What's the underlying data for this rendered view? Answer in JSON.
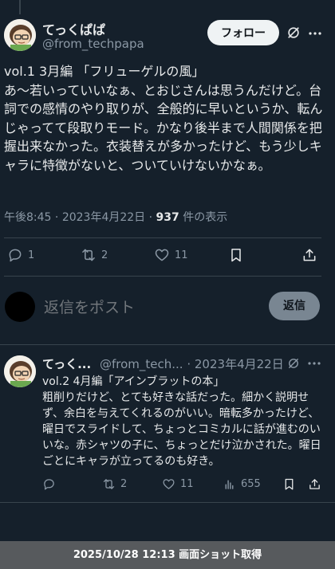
{
  "main_tweet": {
    "author_name": "てっくぱぱ",
    "handle": "@from_techpapa",
    "follow_label": "フォロー",
    "text": "vol.1 3月編 「フリューゲルの風」\nあ〜若いっていいなぁ、とおじさんは思うんだけど。台詞での感情のやり取りが、全般的に早いというか、転んじゃってて段取りモード。かなり後半まで人間関係を把握出来なかった。衣装替えが多かったけど、もう少しキャラに特徴がないと、ついていけないかなぁ。",
    "time": "午後8:45",
    "date": "2023年4月22日",
    "views_count": "937",
    "views_label": "件の表示",
    "replies": "1",
    "reposts": "2",
    "likes": "11"
  },
  "reply_bar": {
    "placeholder": "返信をポスト",
    "button_label": "返信"
  },
  "second_tweet": {
    "author_name": "てっく...",
    "handle": "@from_tech...",
    "date": "2023年4月22日",
    "text": "vol.2 4月編「アインブラットの本」\n粗削りだけど、とても好きな話だった。細かく説明せず、余白を与えてくれるのがいい。暗転多かったけど、曜日でスライドして、ちょっとコミカルに話が進むのいいな。赤シャツの子に、ちょっとだけ泣かされた。曜日ごとにキャラが立ってるのも好き。",
    "reposts": "2",
    "likes": "11",
    "views": "655"
  },
  "footer": {
    "text": "2025/10/28 12:13 画面ショット取得"
  },
  "colors": {
    "background": "#15202b",
    "text": "#e7e9ea",
    "muted": "#8b98a5",
    "divider": "#38444d"
  }
}
